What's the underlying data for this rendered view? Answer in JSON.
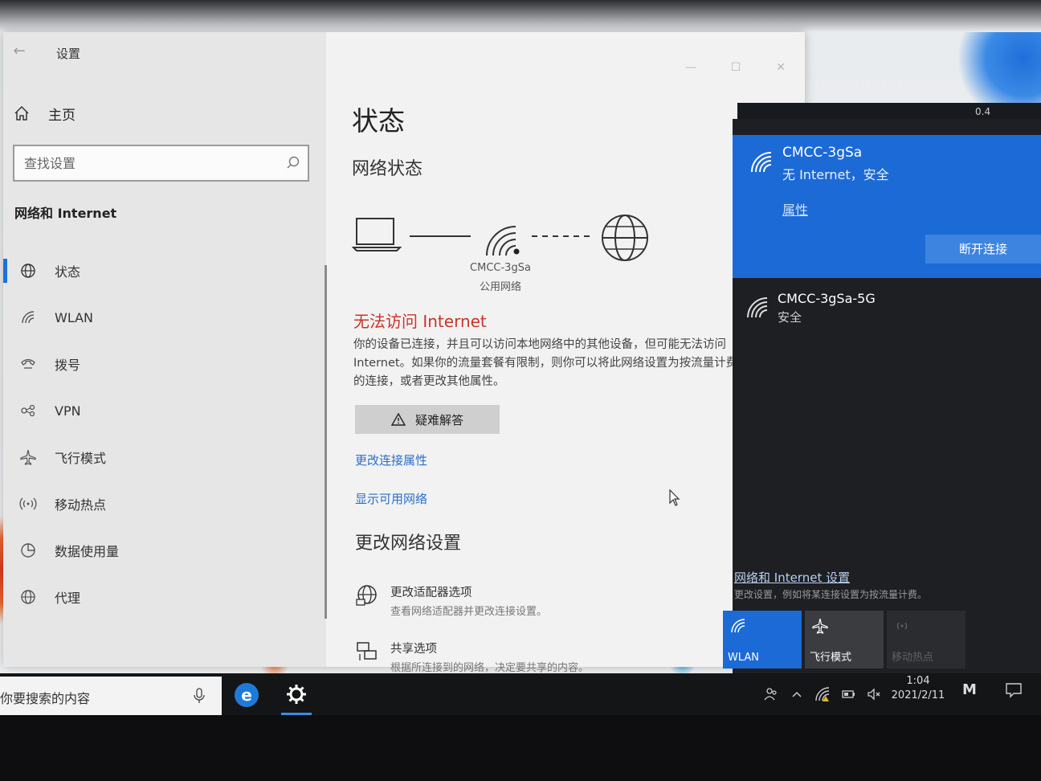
{
  "window": {
    "title": "设置",
    "controls": {
      "minimize": "—",
      "maximize": "☐",
      "close": "✕"
    }
  },
  "sidebar": {
    "home_label": "主页",
    "search_placeholder": "查找设置",
    "section_title": "网络和 Internet",
    "items": [
      {
        "label": "状态",
        "icon": "globe-status-icon",
        "active": true
      },
      {
        "label": "WLAN",
        "icon": "wifi-icon"
      },
      {
        "label": "拨号",
        "icon": "dialup-icon"
      },
      {
        "label": "VPN",
        "icon": "vpn-icon"
      },
      {
        "label": "飞行模式",
        "icon": "airplane-icon"
      },
      {
        "label": "移动热点",
        "icon": "hotspot-icon"
      },
      {
        "label": "数据使用量",
        "icon": "data-usage-icon"
      },
      {
        "label": "代理",
        "icon": "proxy-globe-icon"
      }
    ]
  },
  "main": {
    "page_title": "状态",
    "network_status_title": "网络状态",
    "diagram": {
      "ssid": "CMCC-3gSa",
      "network_type": "公用网络"
    },
    "error_title": "无法访问 Internet",
    "error_body": "你的设备已连接，并且可以访问本地网络中的其他设备，但可能无法访问 Internet。如果你的流量套餐有限制，则你可以将此网络设置为按流量计费的连接，或者更改其他属性。",
    "troubleshoot_label": "疑难解答",
    "link_change_props": "更改连接属性",
    "link_show_networks": "显示可用网络",
    "change_settings_title": "更改网络设置",
    "options": [
      {
        "title": "更改适配器选项",
        "desc": "查看网络适配器并更改连接设置。"
      },
      {
        "title": "共享选项",
        "desc": "根据所连接到的网络，决定要共享的内容。"
      }
    ]
  },
  "flyout": {
    "net_speed": "0.4",
    "connected": {
      "ssid": "CMCC-3gSa",
      "status": "无 Internet，安全",
      "properties_label": "属性",
      "disconnect_label": "断开连接"
    },
    "other_network": {
      "ssid": "CMCC-3gSa-5G",
      "status": "安全"
    },
    "settings_link": "网络和 Internet 设置",
    "settings_desc": "更改设置，例如将某连接设置为按流量计费。",
    "tiles": [
      {
        "label": "WLAN",
        "state": "on"
      },
      {
        "label": "飞行模式",
        "state": "off"
      },
      {
        "label": "移动热点",
        "state": "disabled"
      }
    ]
  },
  "taskbar": {
    "search_text": "你要搜索的内容",
    "time": "1:04",
    "date": "2021/2/11",
    "ime": "M"
  },
  "colors": {
    "accent": "#1c6ad6",
    "error": "#c9342a",
    "link": "#2a6fc9"
  }
}
